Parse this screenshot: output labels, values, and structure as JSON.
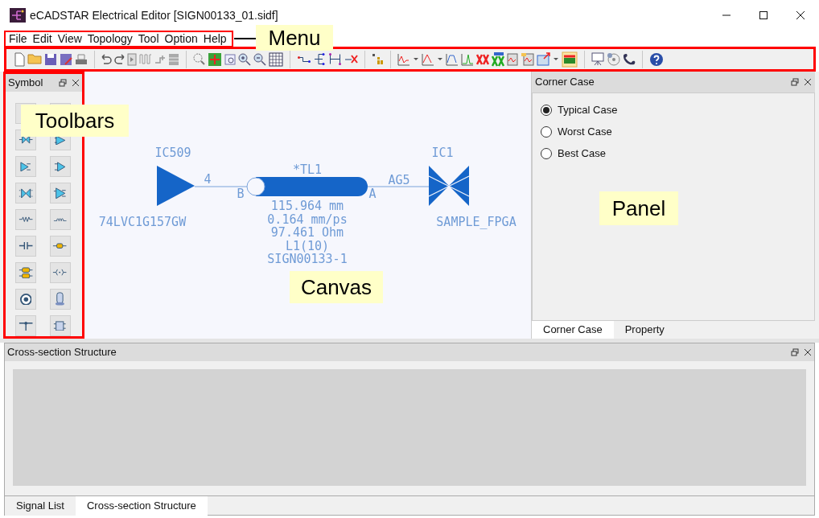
{
  "window": {
    "title": "eCADSTAR Electrical Editor [SIGN00133_01.sidf]"
  },
  "menu": [
    "File",
    "Edit",
    "View",
    "Topology",
    "Tool",
    "Option",
    "Help"
  ],
  "symbol_panel": {
    "title": "Symbol"
  },
  "canvas": {
    "driver": {
      "ref": "IC509",
      "part": "74LVC1G157GW",
      "pin": "4"
    },
    "line": {
      "name": "*TL1",
      "end_b": "B",
      "end_a": "A",
      "properties": [
        "115.964 mm",
        "0.164 mm/ps",
        "97.461 Ohm",
        "L1(10)",
        "SIGN00133-1"
      ]
    },
    "receiver": {
      "ref": "IC1",
      "part": "SAMPLE_FPGA",
      "pin": "AG5"
    }
  },
  "corner_case_panel": {
    "title": "Corner Case",
    "options": [
      {
        "label": "Typical Case",
        "selected": true
      },
      {
        "label": "Worst Case",
        "selected": false
      },
      {
        "label": "Best Case",
        "selected": false
      }
    ],
    "tabs": [
      {
        "label": "Corner Case",
        "selected": true
      },
      {
        "label": "Property",
        "selected": false
      }
    ]
  },
  "cross_section_panel": {
    "title": "Cross-section Structure"
  },
  "bottom_tabs": [
    {
      "label": "Signal List",
      "selected": false
    },
    {
      "label": "Cross-section Structure",
      "selected": true
    }
  ],
  "callouts": [
    "Menu",
    "Toolbars",
    "Canvas",
    "Panel"
  ]
}
